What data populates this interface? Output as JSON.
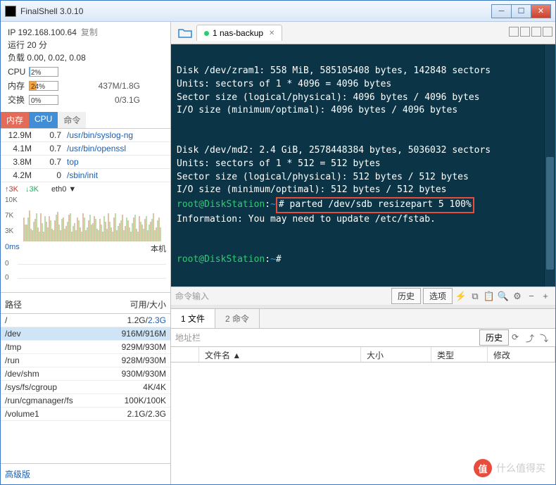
{
  "window": {
    "title": "FinalShell 3.0.10"
  },
  "sidebar": {
    "ip_label": "IP",
    "ip": "192.168.100.64",
    "copy": "复制",
    "uptime": "运行 20 分",
    "load": "负载 0.00, 0.02, 0.08",
    "cpu": {
      "label": "CPU",
      "pct": "2%"
    },
    "mem": {
      "label": "内存",
      "pct": "24%",
      "text": "437M/1.8G"
    },
    "swap": {
      "label": "交换",
      "pct": "0%",
      "text": "0/3.1G"
    },
    "proc_hdr": {
      "c1": "内存",
      "c2": "CPU",
      "c3": "命令"
    },
    "procs": [
      {
        "mem": "12.9M",
        "cpu": "0.7",
        "cmd": "/usr/bin/syslog-ng"
      },
      {
        "mem": "4.1M",
        "cpu": "0.7",
        "cmd": "/usr/bin/openssl"
      },
      {
        "mem": "3.8M",
        "cpu": "0.7",
        "cmd": "top"
      },
      {
        "mem": "4.2M",
        "cpu": "0",
        "cmd": "/sbin/init"
      }
    ],
    "net": {
      "up": "↑3K",
      "dn": "↓3K",
      "iface": "eth0 ▼",
      "y": [
        "10K",
        "7K",
        "3K"
      ]
    },
    "lat": {
      "label": "0ms",
      "right": "本机",
      "y": [
        "0",
        "0"
      ]
    },
    "fs_hdr": {
      "c1": "路径",
      "c2": "可用/大小"
    },
    "fs": [
      {
        "p": "/",
        "s": "1.2G/",
        "l": "2.3G"
      },
      {
        "p": "/dev",
        "s": "916M/916M",
        "sel": true
      },
      {
        "p": "/tmp",
        "s": "929M/930M"
      },
      {
        "p": "/run",
        "s": "928M/930M"
      },
      {
        "p": "/dev/shm",
        "s": "930M/930M"
      },
      {
        "p": "/sys/fs/cgroup",
        "s": "4K/4K"
      },
      {
        "p": "/run/cgmanager/fs",
        "s": "100K/100K"
      },
      {
        "p": "/volume1",
        "s": "2.1G/2.3G"
      }
    ],
    "adv": "高级版"
  },
  "tabs": {
    "tab1": "1 nas-backup"
  },
  "terminal": {
    "lines": [
      "",
      "Disk /dev/zram1: 558 MiB, 585105408 bytes, 142848 sectors",
      "Units: sectors of 1 * 4096 = 4096 bytes",
      "Sector size (logical/physical): 4096 bytes / 4096 bytes",
      "I/O size (minimum/optimal): 4096 bytes / 4096 bytes",
      "",
      "",
      "Disk /dev/md2: 2.4 GiB, 2578448384 bytes, 5036032 sectors",
      "Units: sectors of 1 * 512 = 512 bytes",
      "Sector size (logical/physical): 512 bytes / 512 bytes",
      "I/O size (minimum/optimal): 512 bytes / 512 bytes"
    ],
    "prompt_user": "root@DiskStation",
    "prompt_path": "~",
    "hl_cmd": "# parted /dev/sdb resizepart 5 100%",
    "info_line": "Information: You may need to update /etc/fstab.",
    "input_hint": "命令输入",
    "btn_hist": "历史",
    "btn_opt": "选项"
  },
  "filemgr": {
    "tab1": "1 文件",
    "tab2": "2 命令",
    "addr_hint": "地址栏",
    "btn_hist": "历史",
    "cols": {
      "name": "文件名 ▲",
      "size": "大小",
      "type": "类型",
      "mod": "修改"
    }
  },
  "watermark": "什么值得买"
}
